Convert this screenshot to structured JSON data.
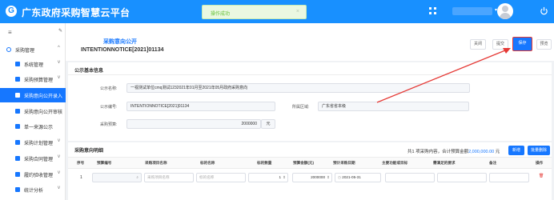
{
  "app": {
    "title": "广东政府采购智慧云平台",
    "logo_char": "G"
  },
  "toast": {
    "message": "操作成功",
    "close": "×"
  },
  "header": {
    "user_caret": "▾"
  },
  "sidebar": {
    "collapse_icon": "≡",
    "pin_icon": "✎",
    "items": [
      {
        "label": "采购管理",
        "caret": "^"
      },
      {
        "label": "系统管理",
        "caret": "v"
      },
      {
        "label": "采购预算管理",
        "caret": "v"
      },
      {
        "label": "采购意向公开录入",
        "caret": ""
      },
      {
        "label": "采购意向公开审核",
        "caret": ""
      },
      {
        "label": "单一来源公示",
        "caret": ""
      },
      {
        "label": "采购计划管理",
        "caret": "v"
      },
      {
        "label": "采购合同管理",
        "caret": "v"
      },
      {
        "label": "履约验收管理",
        "caret": "v"
      },
      {
        "label": "统计分析",
        "caret": "v"
      }
    ]
  },
  "page": {
    "title": "采购意向公开",
    "subtitle": "INTENTIONNOTICE[2021]01134",
    "buttons": {
      "close": "关闭",
      "submit": "提交",
      "save": "保存",
      "preview": "预览"
    }
  },
  "basic_info": {
    "section_title": "公示基本信息",
    "fields": {
      "name_label": "公示名称:",
      "name_value": "一视测试单位cmq测试1232021年01月至2021年05月政府采购意向",
      "code_label": "公示编号:",
      "code_value": "INTENTIONNOTICE[2021]01134",
      "region_label": "所属区域:",
      "region_value": "广东省省本级",
      "budget_label": "采购预算:",
      "budget_value": "2000000",
      "budget_unit": "元"
    }
  },
  "detail": {
    "section_title": "采购意向明细",
    "summary_prefix": "共1 项采购内容，合计预算金额",
    "summary_amount": "2,000,000.00",
    "summary_suffix": " 元",
    "buttons": {
      "add": "新增",
      "batch_delete": "批量删除"
    },
    "columns": [
      "序号",
      "预算编号",
      "采购项目名称",
      "标的名称",
      "标的数量",
      "预算金额(元)",
      "预计采购日期",
      "主要功能或目标",
      "需满足的要求",
      "备注",
      "操作"
    ],
    "rows": [
      {
        "index": "1",
        "budget_no": "",
        "search_icon": "⌕",
        "project_placeholder": "采购项目名称",
        "subject_placeholder": "标的名称",
        "quantity": "1",
        "amount": "2000000",
        "date": "2021-05-31",
        "calendar_icon": "◷",
        "delete_icon": "🗑"
      }
    ]
  },
  "colors": {
    "primary": "#1677ff",
    "topbar": "#1890ff",
    "highlight": "#e53935",
    "toast_text": "#67c23a"
  }
}
